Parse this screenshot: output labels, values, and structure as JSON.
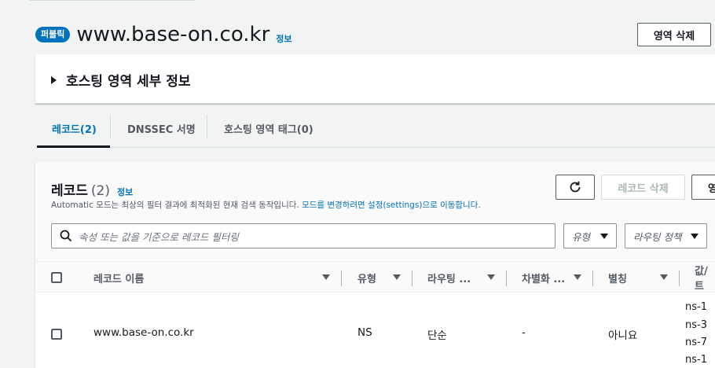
{
  "header": {
    "badge": "퍼블릭",
    "title": "www.base-on.co.kr",
    "info": "정보",
    "delete_zone_label": "영역 삭제"
  },
  "details": {
    "label": "호스팅 영역 세부 정보"
  },
  "tabs": [
    {
      "label": "레코드(2)",
      "active": true
    },
    {
      "label": "DNSSEC 서명",
      "active": false
    },
    {
      "label": "호스팅 영역 태그(0)",
      "active": false
    }
  ],
  "records": {
    "title": "레코드",
    "count": "(2)",
    "info": "정보",
    "desc_prefix": "Automatic 모드는 최상의 필터 결과에 최적화된 현재 검색 동작입니다.",
    "desc_link": "모드를 변경하려면 설정(settings)으로 이동합니다.",
    "refresh_icon": "refresh-icon",
    "delete_label": "레코드 삭제",
    "cut_label": "영",
    "search_placeholder": "속성 또는 값을 기준으로 레코드 필터링",
    "type_filter": "유형",
    "routing_filter": "라우팅 정책"
  },
  "table": {
    "columns": [
      "레코드 이름",
      "유형",
      "라우팅 ...",
      "차별화 ...",
      "별칭",
      "값/트"
    ],
    "rows": [
      {
        "name": "www.base-on.co.kr",
        "type": "NS",
        "routing": "단순",
        "diff": "-",
        "alias": "아니요",
        "values": [
          "ns-1",
          "ns-3",
          "ns-7",
          "ns-1"
        ]
      }
    ]
  },
  "colors": {
    "accent": "#0073bb",
    "text": "#16191f",
    "muted": "#545b64",
    "background": "#f2f3f3"
  }
}
